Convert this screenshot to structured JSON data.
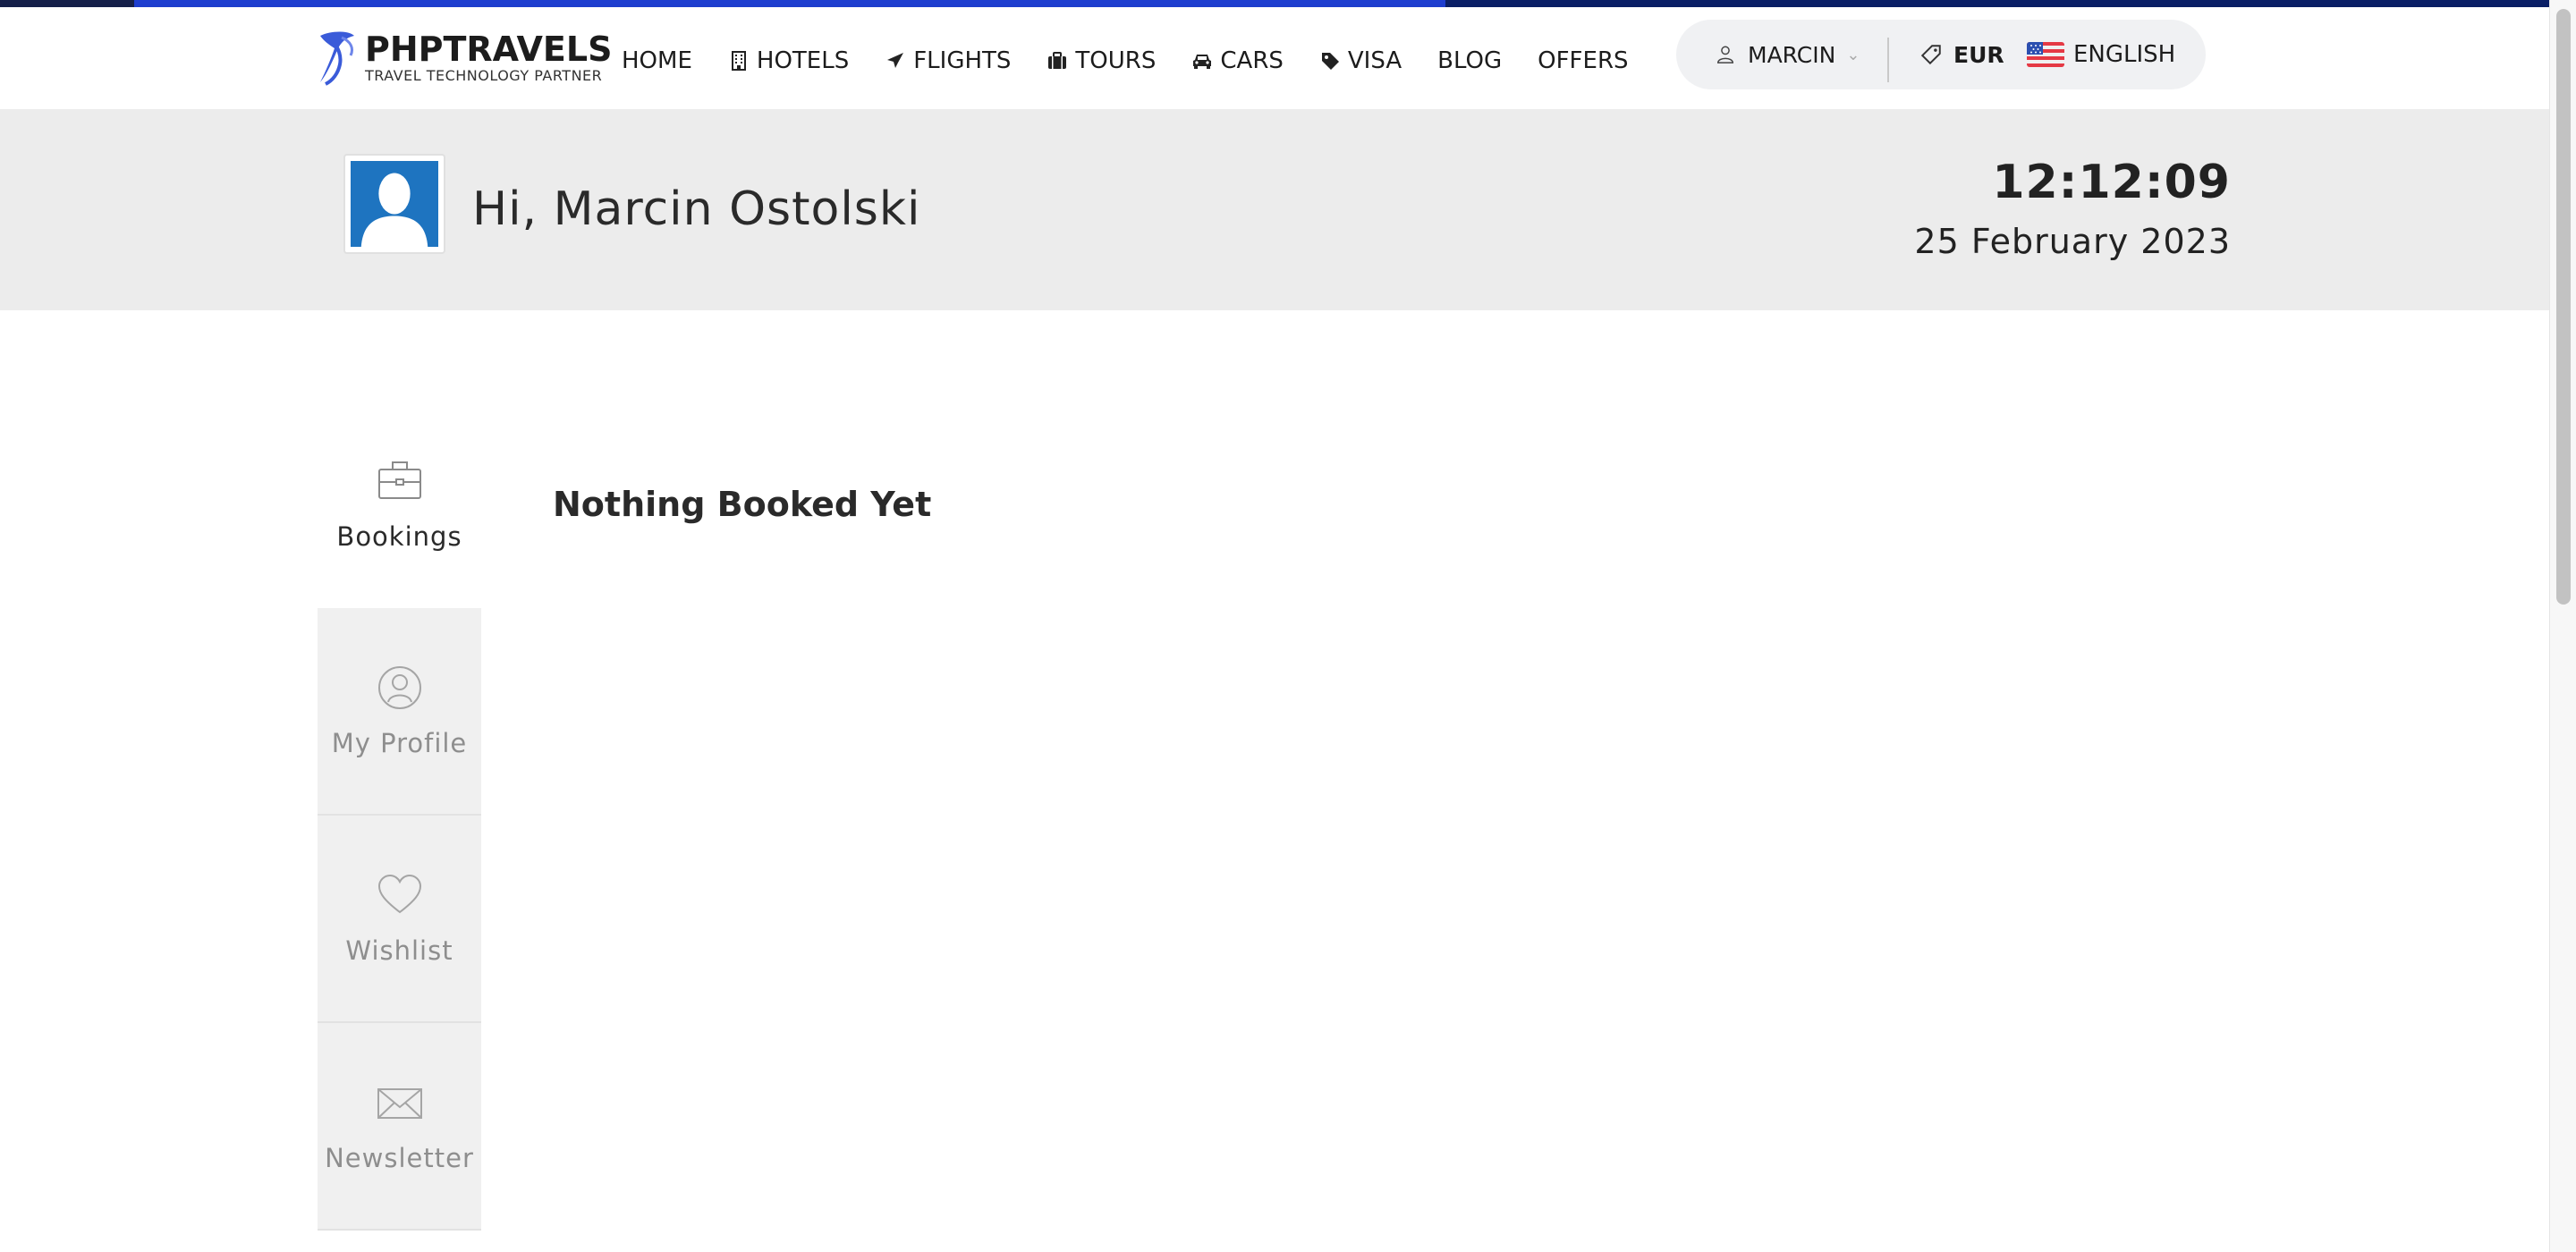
{
  "brand": {
    "name": "PHPTRAVELS",
    "tagline": "TRAVEL TECHNOLOGY PARTNER",
    "logo_color": "#3a5bd9"
  },
  "nav": {
    "items": [
      {
        "label": "HOME",
        "icon": ""
      },
      {
        "label": "HOTELS",
        "icon": "building-icon"
      },
      {
        "label": "FLIGHTS",
        "icon": "plane-icon"
      },
      {
        "label": "TOURS",
        "icon": "suitcase-icon"
      },
      {
        "label": "CARS",
        "icon": "car-icon"
      },
      {
        "label": "VISA",
        "icon": "tag-icon"
      },
      {
        "label": "BLOG",
        "icon": ""
      },
      {
        "label": "OFFERS",
        "icon": ""
      }
    ]
  },
  "account": {
    "user": "MARCIN",
    "currency": "EUR",
    "language": "ENGLISH"
  },
  "greeting": {
    "text": "Hi, Marcin Ostolski",
    "time": "12:12:09",
    "date": "25 February 2023"
  },
  "sidebar": {
    "items": [
      {
        "label": "Bookings",
        "icon": "briefcase-icon",
        "active": true
      },
      {
        "label": "My Profile",
        "icon": "user-circle-icon",
        "active": false
      },
      {
        "label": "Wishlist",
        "icon": "heart-icon",
        "active": false
      },
      {
        "label": "Newsletter",
        "icon": "envelope-icon",
        "active": false
      }
    ]
  },
  "main": {
    "title": "Nothing Booked Yet"
  },
  "colors": {
    "accent": "#1e3ecf",
    "band": "#ececec",
    "avatar": "#1e74c0"
  }
}
